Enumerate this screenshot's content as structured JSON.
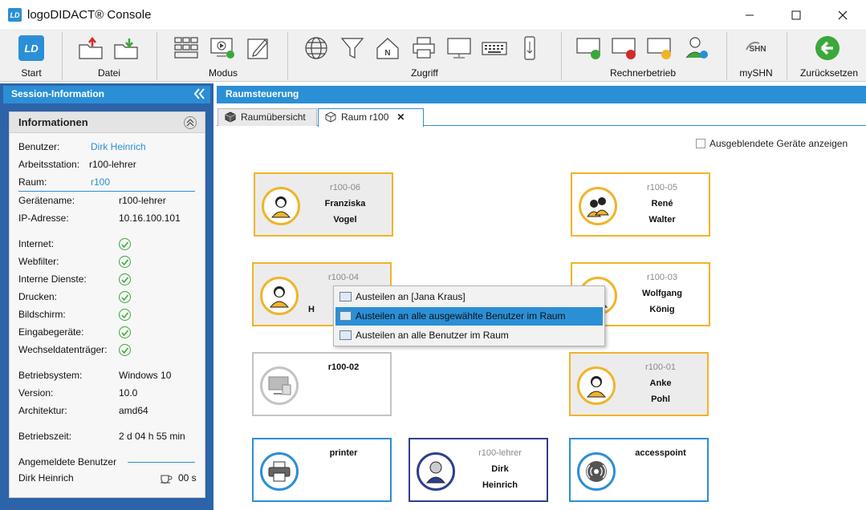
{
  "window": {
    "title": "logoDIDACT® Console",
    "logo_text": "LD"
  },
  "ribbon": {
    "groups": [
      {
        "label": "Start"
      },
      {
        "label": "Datei"
      },
      {
        "label": "Modus"
      },
      {
        "label": "Zugriff"
      },
      {
        "label": "Rechnerbetrieb"
      },
      {
        "label": "mySHN"
      },
      {
        "label": "Zurücksetzen"
      }
    ],
    "shn_text": "SHN"
  },
  "session": {
    "header": "Session-Information",
    "panel_title": "Informationen",
    "user_label": "Benutzer:",
    "user_value": "Dirk Heinrich",
    "station_label": "Arbeitsstation:",
    "station_value": "r100-lehrer",
    "room_label": "Raum:",
    "room_value": "r100",
    "device_label": "Gerätename:",
    "device_value": "r100-lehrer",
    "ip_label": "IP-Adresse:",
    "ip_value": "10.16.100.101",
    "services": [
      "Internet:",
      "Webfilter:",
      "Interne Dienste:",
      "Drucken:",
      "Bildschirm:",
      "Eingabegeräte:",
      "Wechseldatenträger:"
    ],
    "os_label": "Betriebsystem:",
    "os_value": "Windows 10",
    "version_label": "Version:",
    "version_value": "10.0",
    "arch_label": "Architektur:",
    "arch_value": "amd64",
    "uptime_label": "Betriebszeit:",
    "uptime_value": "2 d 04 h 55 min",
    "logged_label": "Angemeldete Benutzer",
    "logged_user": "Dirk Heinrich",
    "logged_time": "00 s"
  },
  "room_control": {
    "header": "Raumsteuerung",
    "tabs": [
      {
        "label": "Raumübersicht"
      },
      {
        "label": "Raum r100"
      }
    ],
    "hidden_devices_label": "Ausgeblendete Geräte anzeigen",
    "devices": [
      {
        "id": "r100-06",
        "line1": "Franziska",
        "line2": "Vogel"
      },
      {
        "id": "r100-05",
        "line1": "René",
        "line2": "Walter"
      },
      {
        "id": "r100-04",
        "line1": "H",
        "line2": ""
      },
      {
        "id": "r100-03",
        "line1": "Wolfgang",
        "line2": "König"
      },
      {
        "id": "",
        "line1": "r100-02",
        "line2": ""
      },
      {
        "id": "r100-01",
        "line1": "Anke",
        "line2": "Pohl"
      },
      {
        "id": "",
        "line1": "printer",
        "line2": ""
      },
      {
        "id": "r100-lehrer",
        "line1": "Dirk",
        "line2": "Heinrich"
      },
      {
        "id": "",
        "line1": "accesspoint",
        "line2": ""
      }
    ]
  },
  "context_menu": {
    "items": [
      {
        "label": "Austeilen an [Jana Kraus]"
      },
      {
        "label": "Austeilen an alle ausgewählte Benutzer im Raum"
      },
      {
        "label": "Austeilen an alle Benutzer im Raum"
      }
    ]
  },
  "colors": {
    "accent": "#2b8fd6",
    "left_bg": "#2d63a8",
    "selected": "#f0b429",
    "ok": "#3aa83a"
  }
}
